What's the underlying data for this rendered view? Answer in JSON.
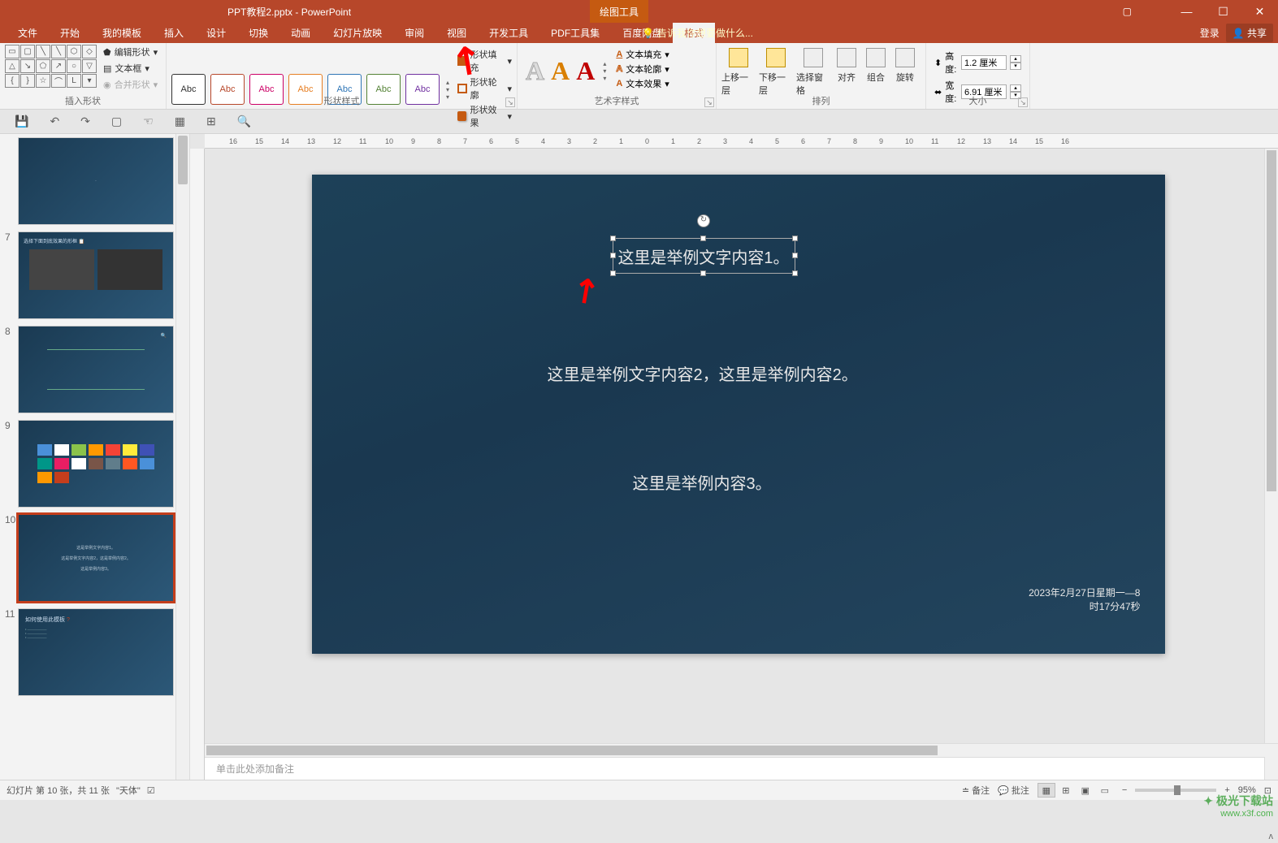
{
  "titlebar": {
    "filename": "PPT教程2.pptx - PowerPoint",
    "context_tab": "绘图工具",
    "ribbon_display": "▢",
    "minimize": "—",
    "maximize": "☐",
    "close": "✕"
  },
  "menu": {
    "tabs": [
      "文件",
      "开始",
      "我的模板",
      "插入",
      "设计",
      "切换",
      "动画",
      "幻灯片放映",
      "审阅",
      "视图",
      "开发工具",
      "PDF工具集",
      "百度网盘",
      "格式"
    ],
    "active_index": 13,
    "tell_me_placeholder": "告诉我你想要做什么...",
    "login": "登录",
    "share": "共享"
  },
  "ribbon": {
    "groups": {
      "insert_shapes": {
        "label": "插入形状",
        "edit_shape": "编辑形状",
        "text_box": "文本框",
        "merge_shapes": "合并形状"
      },
      "shape_styles": {
        "label": "形状样式",
        "sample": "Abc",
        "fill": "形状填充",
        "outline": "形状轮廓",
        "effects": "形状效果"
      },
      "wordart_styles": {
        "label": "艺术字样式",
        "sample": "A",
        "text_fill": "文本填充",
        "text_outline": "文本轮廓",
        "text_effects": "文本效果"
      },
      "arrange": {
        "label": "排列",
        "bring_forward": "上移一层",
        "send_backward": "下移一层",
        "selection_pane": "选择窗格",
        "align": "对齐",
        "group": "组合",
        "rotate": "旋转"
      },
      "size": {
        "label": "大小",
        "height_label": "高度:",
        "height_value": "1.2 厘米",
        "width_label": "宽度:",
        "width_value": "6.91 厘米"
      }
    }
  },
  "qat": {
    "save": "💾",
    "undo": "↶",
    "redo": "↷",
    "slideshow": "▢",
    "touch": "☜"
  },
  "ruler_ticks": [
    "16",
    "15",
    "14",
    "13",
    "12",
    "11",
    "10",
    "9",
    "8",
    "7",
    "6",
    "5",
    "4",
    "3",
    "2",
    "1",
    "0",
    "1",
    "2",
    "3",
    "4",
    "5",
    "6",
    "7",
    "8",
    "9",
    "10",
    "11",
    "12",
    "13",
    "14",
    "15",
    "16"
  ],
  "thumbnails": [
    {
      "num": "",
      "active": false
    },
    {
      "num": "7",
      "active": false
    },
    {
      "num": "8",
      "active": false
    },
    {
      "num": "9",
      "active": false
    },
    {
      "num": "10",
      "active": true
    },
    {
      "num": "11",
      "active": false
    }
  ],
  "slide": {
    "text1": "这里是举例文字内容1。",
    "text2": "这里是举例文字内容2，这里是举例内容2。",
    "text3": "这里是举例内容3。",
    "date_line1": "2023年2月27日星期一—8",
    "date_line2": "时17分47秒"
  },
  "notes": {
    "placeholder": "单击此处添加备注"
  },
  "statusbar": {
    "slide_info": "幻灯片 第 10 张，共 11 张",
    "lang": "\"天体\"",
    "spelling": "☑",
    "notes_btn": "备注",
    "comments_btn": "批注",
    "zoom_out": "−",
    "zoom_in": "+",
    "zoom_pct": "95%",
    "fit": "⊡"
  },
  "watermark": {
    "logo": "✦ 极光下载站",
    "url": "www.x3f.com"
  }
}
